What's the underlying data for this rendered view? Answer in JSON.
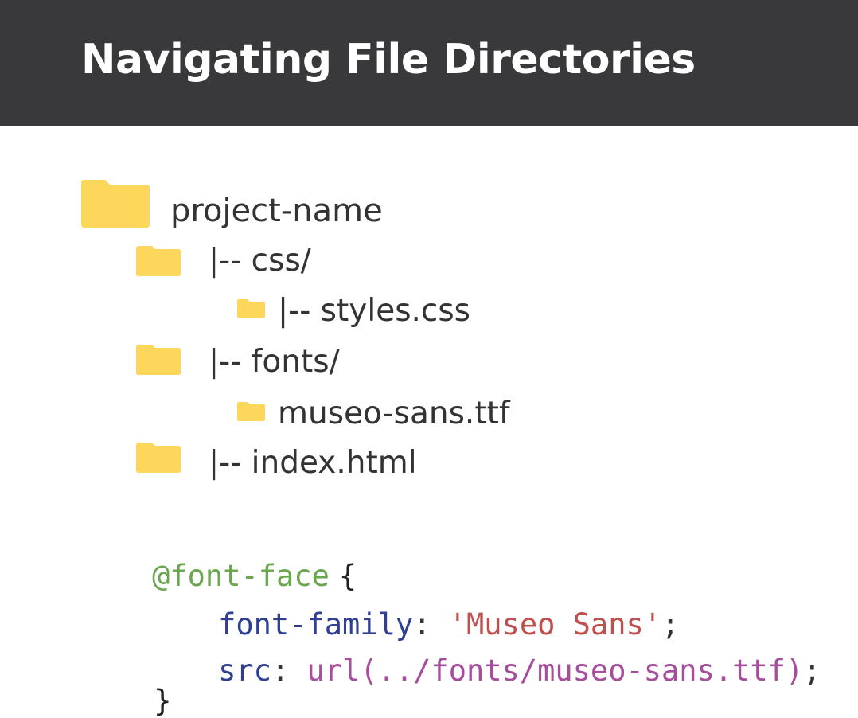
{
  "header": {
    "title": "Navigating File Directories"
  },
  "tree": {
    "root": "project-name",
    "items": [
      {
        "label": "|-- css/"
      },
      {
        "label": "|-- styles.css"
      },
      {
        "label": "|-- fonts/"
      },
      {
        "label": "museo-sans.ttf"
      },
      {
        "label": "|-- index.html"
      }
    ]
  },
  "code": {
    "at_rule": "@font-face",
    "open_brace": "{",
    "close_brace": "}",
    "prop1": "font-family",
    "colon": ":",
    "value1": "'Museo Sans'",
    "semicolon": ";",
    "prop2": "src",
    "value2": "url(../fonts/museo-sans.ttf)"
  },
  "colors": {
    "header_bg": "#39393c",
    "folder": "#fdd65c",
    "at_rule": "#6aa84f",
    "property": "#2f3f91",
    "string": "#c0504d",
    "url": "#a64d9c"
  },
  "icons": [
    "folder-icon"
  ]
}
